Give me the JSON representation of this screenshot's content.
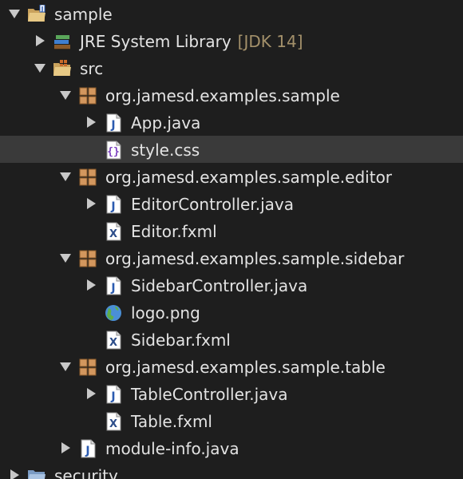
{
  "tree": {
    "rows": [
      {
        "name": "project-sample",
        "depth": 0,
        "arrow": "down",
        "icon": "java-project-folder-icon",
        "label": "sample",
        "decoration": "",
        "selected": false
      },
      {
        "name": "jre-system-library",
        "depth": 1,
        "arrow": "right",
        "icon": "library-books-icon",
        "label": "JRE System Library",
        "decoration": "[JDK 14]",
        "selected": false
      },
      {
        "name": "src-folder",
        "depth": 1,
        "arrow": "down",
        "icon": "source-folder-icon",
        "label": "src",
        "decoration": "",
        "selected": false
      },
      {
        "name": "package-sample",
        "depth": 2,
        "arrow": "down",
        "icon": "package-icon",
        "label": "org.jamesd.examples.sample",
        "decoration": "",
        "selected": false
      },
      {
        "name": "file-app-java",
        "depth": 3,
        "arrow": "right",
        "icon": "java-file-icon",
        "label": "App.java",
        "decoration": "",
        "selected": false
      },
      {
        "name": "file-style-css",
        "depth": 3,
        "arrow": "none",
        "icon": "css-file-icon",
        "label": "style.css",
        "decoration": "",
        "selected": true
      },
      {
        "name": "package-sample-editor",
        "depth": 2,
        "arrow": "down",
        "icon": "package-icon",
        "label": "org.jamesd.examples.sample.editor",
        "decoration": "",
        "selected": false
      },
      {
        "name": "file-editorcontroller-java",
        "depth": 3,
        "arrow": "right",
        "icon": "java-file-icon",
        "label": "EditorController.java",
        "decoration": "",
        "selected": false
      },
      {
        "name": "file-editor-fxml",
        "depth": 3,
        "arrow": "none",
        "icon": "xml-file-icon",
        "label": "Editor.fxml",
        "decoration": "",
        "selected": false
      },
      {
        "name": "package-sample-sidebar",
        "depth": 2,
        "arrow": "down",
        "icon": "package-icon",
        "label": "org.jamesd.examples.sample.sidebar",
        "decoration": "",
        "selected": false
      },
      {
        "name": "file-sidebarcontroller-java",
        "depth": 3,
        "arrow": "right",
        "icon": "java-file-icon",
        "label": "SidebarController.java",
        "decoration": "",
        "selected": false
      },
      {
        "name": "file-logo-png",
        "depth": 3,
        "arrow": "none",
        "icon": "globe-image-icon",
        "label": "logo.png",
        "decoration": "",
        "selected": false
      },
      {
        "name": "file-sidebar-fxml",
        "depth": 3,
        "arrow": "none",
        "icon": "xml-file-icon",
        "label": "Sidebar.fxml",
        "decoration": "",
        "selected": false
      },
      {
        "name": "package-sample-table",
        "depth": 2,
        "arrow": "down",
        "icon": "package-icon",
        "label": "org.jamesd.examples.sample.table",
        "decoration": "",
        "selected": false
      },
      {
        "name": "file-tablecontroller-java",
        "depth": 3,
        "arrow": "right",
        "icon": "java-file-icon",
        "label": "TableController.java",
        "decoration": "",
        "selected": false
      },
      {
        "name": "file-table-fxml",
        "depth": 3,
        "arrow": "none",
        "icon": "xml-file-icon",
        "label": "Table.fxml",
        "decoration": "",
        "selected": false
      },
      {
        "name": "file-module-info-java",
        "depth": 2,
        "arrow": "right",
        "icon": "java-file-icon",
        "label": "module-info.java",
        "decoration": "",
        "selected": false
      },
      {
        "name": "project-security",
        "depth": 0,
        "arrow": "right",
        "icon": "project-folder-icon",
        "label": "security",
        "decoration": "",
        "selected": false
      }
    ]
  }
}
